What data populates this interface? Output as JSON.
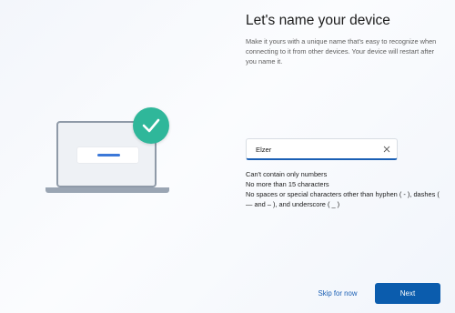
{
  "page": {
    "title": "Let's name your device",
    "description": "Make it yours with a unique name that's easy to recognize when connecting to it from other devices. Your device will restart after you name it."
  },
  "name_field": {
    "value": "Elzer",
    "clear_icon": "close-icon"
  },
  "rules": [
    "Can't contain only numbers",
    "No more than 15 characters",
    "No spaces or special characters other than hyphen ( - ), dashes ( — and – ), and underscore ( _ )"
  ],
  "buttons": {
    "skip_label": "Skip for now",
    "next_label": "Next"
  },
  "illustration": {
    "icons": [
      "laptop-icon",
      "checkmark-badge-icon"
    ],
    "accent_color": "#2fb79a",
    "bar_color": "#3b78d8"
  },
  "colors": {
    "primary_button": "#0b5cad",
    "link": "#1a5fb4"
  }
}
